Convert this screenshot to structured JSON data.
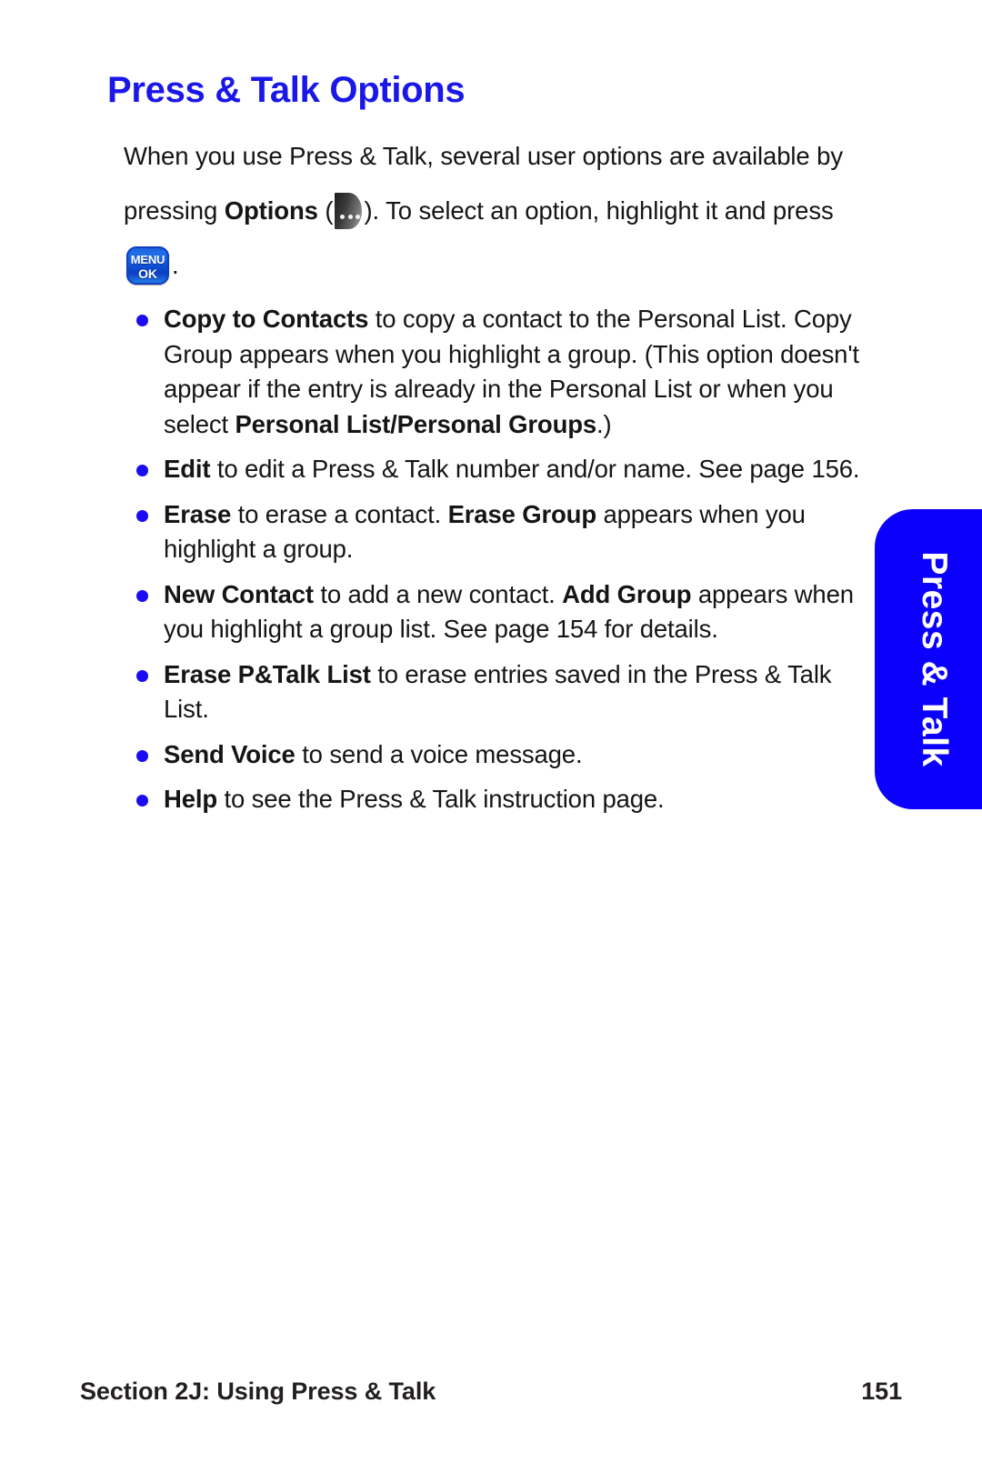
{
  "page": {
    "title": "Press & Talk Options",
    "title_color": "#1a18e8"
  },
  "intro": {
    "part1": "When you use Press & Talk, several user options are available by pressing ",
    "options_bold": "Options",
    "part2": " (",
    "part3": "). To select an option, highlight it and press ",
    "part4": "."
  },
  "icons": {
    "softkey": {
      "name": "options-softkey-icon",
      "dot_count": 3,
      "color": "#3b3b3b"
    },
    "menu_ok": {
      "name": "menu-ok-key-icon",
      "line1": "MENU",
      "line2": "OK",
      "color": "#1052d6"
    }
  },
  "options": [
    {
      "id": "copy-to-contacts",
      "segments": [
        {
          "text": "Copy to Contacts",
          "bold": true
        },
        {
          "text": " to copy a contact to the Personal List. Copy Group appears when you highlight a group. (This option doesn't appear if the entry is already in the Personal List or when you select ",
          "bold": false
        },
        {
          "text": "Personal List/Personal Groups",
          "bold": true
        },
        {
          "text": ".)",
          "bold": false
        }
      ]
    },
    {
      "id": "edit",
      "segments": [
        {
          "text": "Edit",
          "bold": true
        },
        {
          "text": " to edit a Press & Talk number and/or name. See page 156.",
          "bold": false
        }
      ]
    },
    {
      "id": "erase",
      "segments": [
        {
          "text": "Erase",
          "bold": true
        },
        {
          "text": " to erase a contact. ",
          "bold": false
        },
        {
          "text": "Erase Group",
          "bold": true
        },
        {
          "text": " appears when you highlight a group.",
          "bold": false
        }
      ]
    },
    {
      "id": "new-contact",
      "segments": [
        {
          "text": "New Contact",
          "bold": true
        },
        {
          "text": " to add a new contact. ",
          "bold": false
        },
        {
          "text": "Add Group",
          "bold": true
        },
        {
          "text": " appears when you highlight a group list. See page 154 for details.",
          "bold": false
        }
      ]
    },
    {
      "id": "erase-ptalk-list",
      "segments": [
        {
          "text": "Erase P&Talk List",
          "bold": true
        },
        {
          "text": " to erase entries saved in the Press & Talk List.",
          "bold": false
        }
      ]
    },
    {
      "id": "send-voice",
      "segments": [
        {
          "text": "Send Voice",
          "bold": true
        },
        {
          "text": " to send a voice message.",
          "bold": false
        }
      ]
    },
    {
      "id": "help",
      "segments": [
        {
          "text": "Help",
          "bold": true
        },
        {
          "text": " to see the Press & Talk instruction page.",
          "bold": false
        }
      ]
    }
  ],
  "side_tab": {
    "label": "Press & Talk",
    "color": "#0b00fb"
  },
  "footer": {
    "section": "Section 2J: Using Press & Talk",
    "page_number": "151"
  }
}
